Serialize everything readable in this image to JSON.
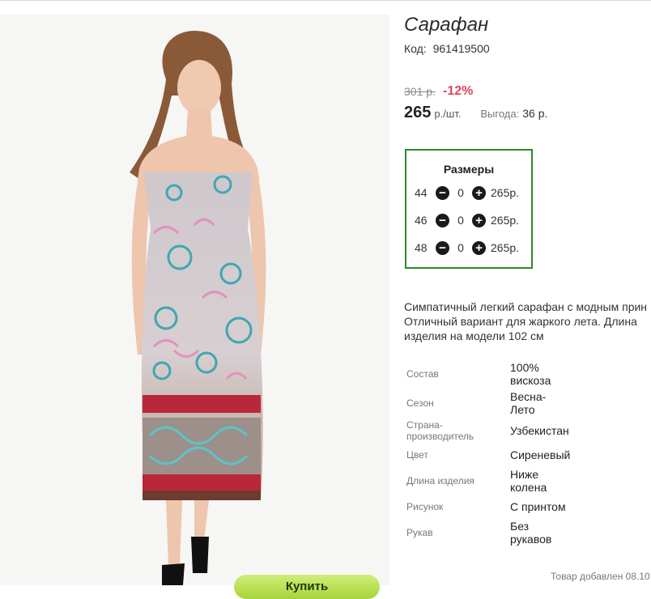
{
  "product": {
    "title": "Сарафан",
    "code_label": "Код:",
    "code": "961419500",
    "old_price": "301 р.",
    "discount": "-12%",
    "price": "265",
    "price_unit": "р./шт.",
    "benefit_label": "Выгода:",
    "benefit_value": "36 р."
  },
  "sizes": {
    "title": "Размеры",
    "rows": [
      {
        "size": "44",
        "qty": "0",
        "price": "265р."
      },
      {
        "size": "46",
        "qty": "0",
        "price": "265р."
      },
      {
        "size": "48",
        "qty": "0",
        "price": "265р."
      }
    ]
  },
  "description": [
    "Симпатичный легкий сарафан с модным прин",
    "Отличный вариант для жаркого лета. Длина",
    "изделия на модели 102 см"
  ],
  "attributes": [
    {
      "label": "Состав",
      "value": [
        "100%",
        "вискоза"
      ]
    },
    {
      "label": "Сезон",
      "value": [
        "Весна-",
        "Лето"
      ]
    },
    {
      "label": [
        "Страна-",
        "производитель"
      ],
      "value": [
        "Узбекистан"
      ]
    },
    {
      "label": "Цвет",
      "value": [
        "Сиреневый"
      ]
    },
    {
      "label": "Длина изделия",
      "value": [
        "Ниже",
        "колена"
      ]
    },
    {
      "label": "Рисунок",
      "value": [
        "С принтом"
      ]
    },
    {
      "label": "Рукав",
      "value": [
        "Без",
        "рукавов"
      ]
    }
  ],
  "added_text": "Товар добавлен 08.10",
  "cart_button_label": "Купить",
  "icons": {
    "minus": "minus-circle-icon",
    "plus": "plus-circle-icon"
  },
  "colors": {
    "accent_green": "#2a8a2a",
    "discount_red": "#e0435e",
    "button_green": "#a7d43a"
  }
}
